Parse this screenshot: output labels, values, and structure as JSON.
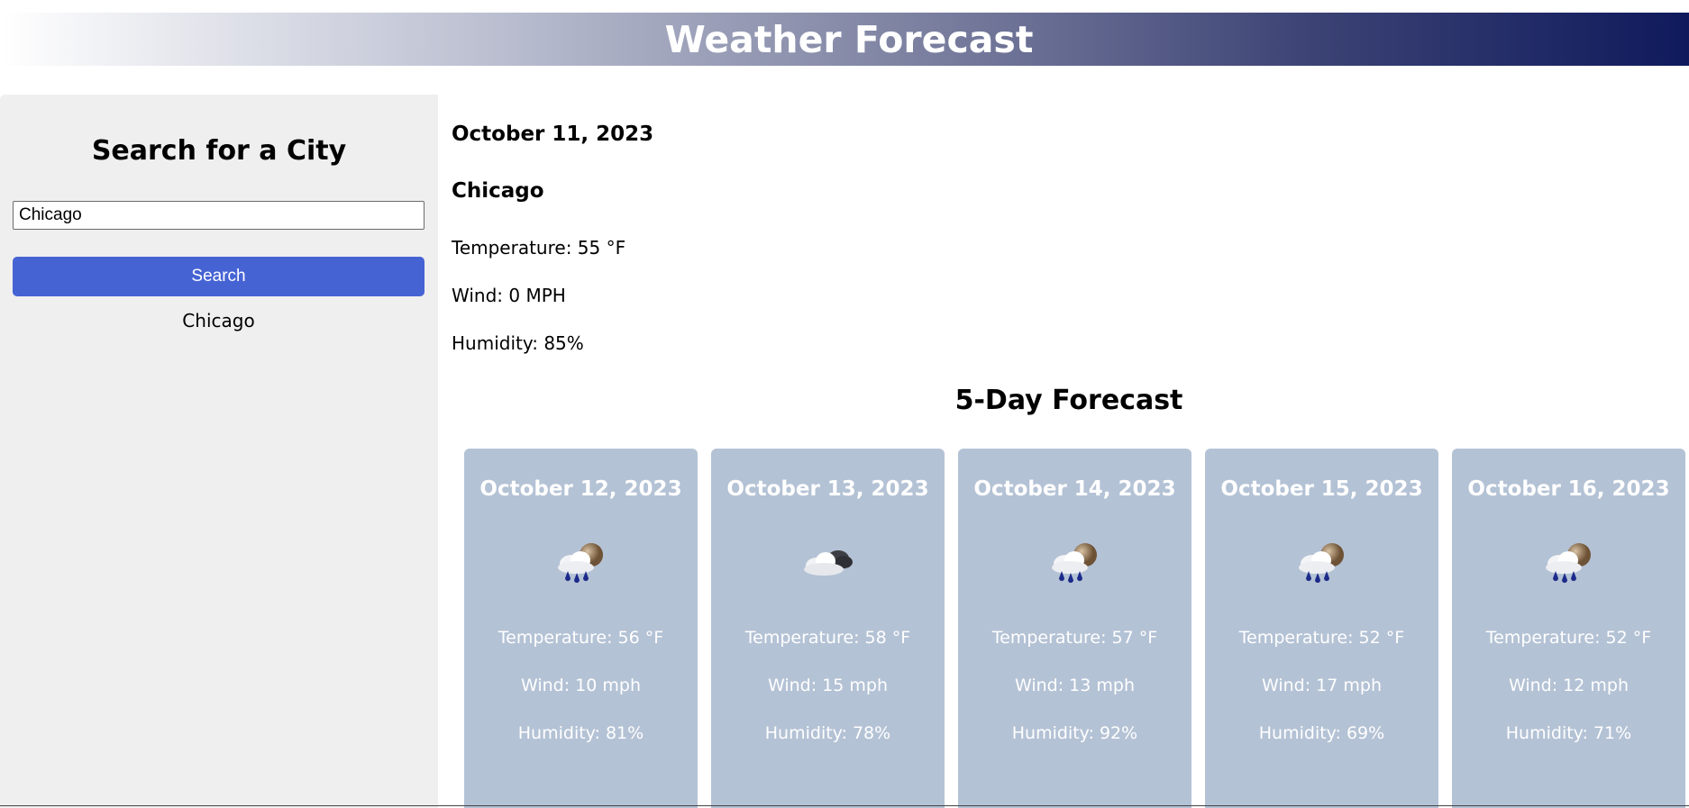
{
  "header": {
    "title": "Weather Forecast"
  },
  "sidebar": {
    "heading": "Search for a City",
    "search_value": "Chicago",
    "search_button": "Search",
    "history": [
      "Chicago"
    ]
  },
  "current": {
    "date": "October 11, 2023",
    "city": "Chicago",
    "temperature": "Temperature: 55 °F",
    "wind": "Wind: 0 MPH",
    "humidity": "Humidity: 85%"
  },
  "forecast": {
    "title": "5-Day Forecast",
    "days": [
      {
        "date": "October 12, 2023",
        "icon": "rain-cloud-night-icon",
        "temperature": "Temperature: 56 °F",
        "wind": "Wind: 10 mph",
        "humidity": "Humidity: 81%"
      },
      {
        "date": "October 13, 2023",
        "icon": "cloudy-icon",
        "temperature": "Temperature: 58 °F",
        "wind": "Wind: 15 mph",
        "humidity": "Humidity: 78%"
      },
      {
        "date": "October 14, 2023",
        "icon": "rain-cloud-night-icon",
        "temperature": "Temperature: 57 °F",
        "wind": "Wind: 13 mph",
        "humidity": "Humidity: 92%"
      },
      {
        "date": "October 15, 2023",
        "icon": "rain-cloud-night-icon",
        "temperature": "Temperature: 52 °F",
        "wind": "Wind: 17 mph",
        "humidity": "Humidity: 69%"
      },
      {
        "date": "October 16, 2023",
        "icon": "rain-cloud-night-icon",
        "temperature": "Temperature: 52 °F",
        "wind": "Wind: 12 mph",
        "humidity": "Humidity: 71%"
      }
    ]
  },
  "colors": {
    "button": "#4663d4",
    "card_bg": "#b4c2d5",
    "sidebar_bg": "#efefef",
    "header_dark": "#0f1a5c"
  }
}
